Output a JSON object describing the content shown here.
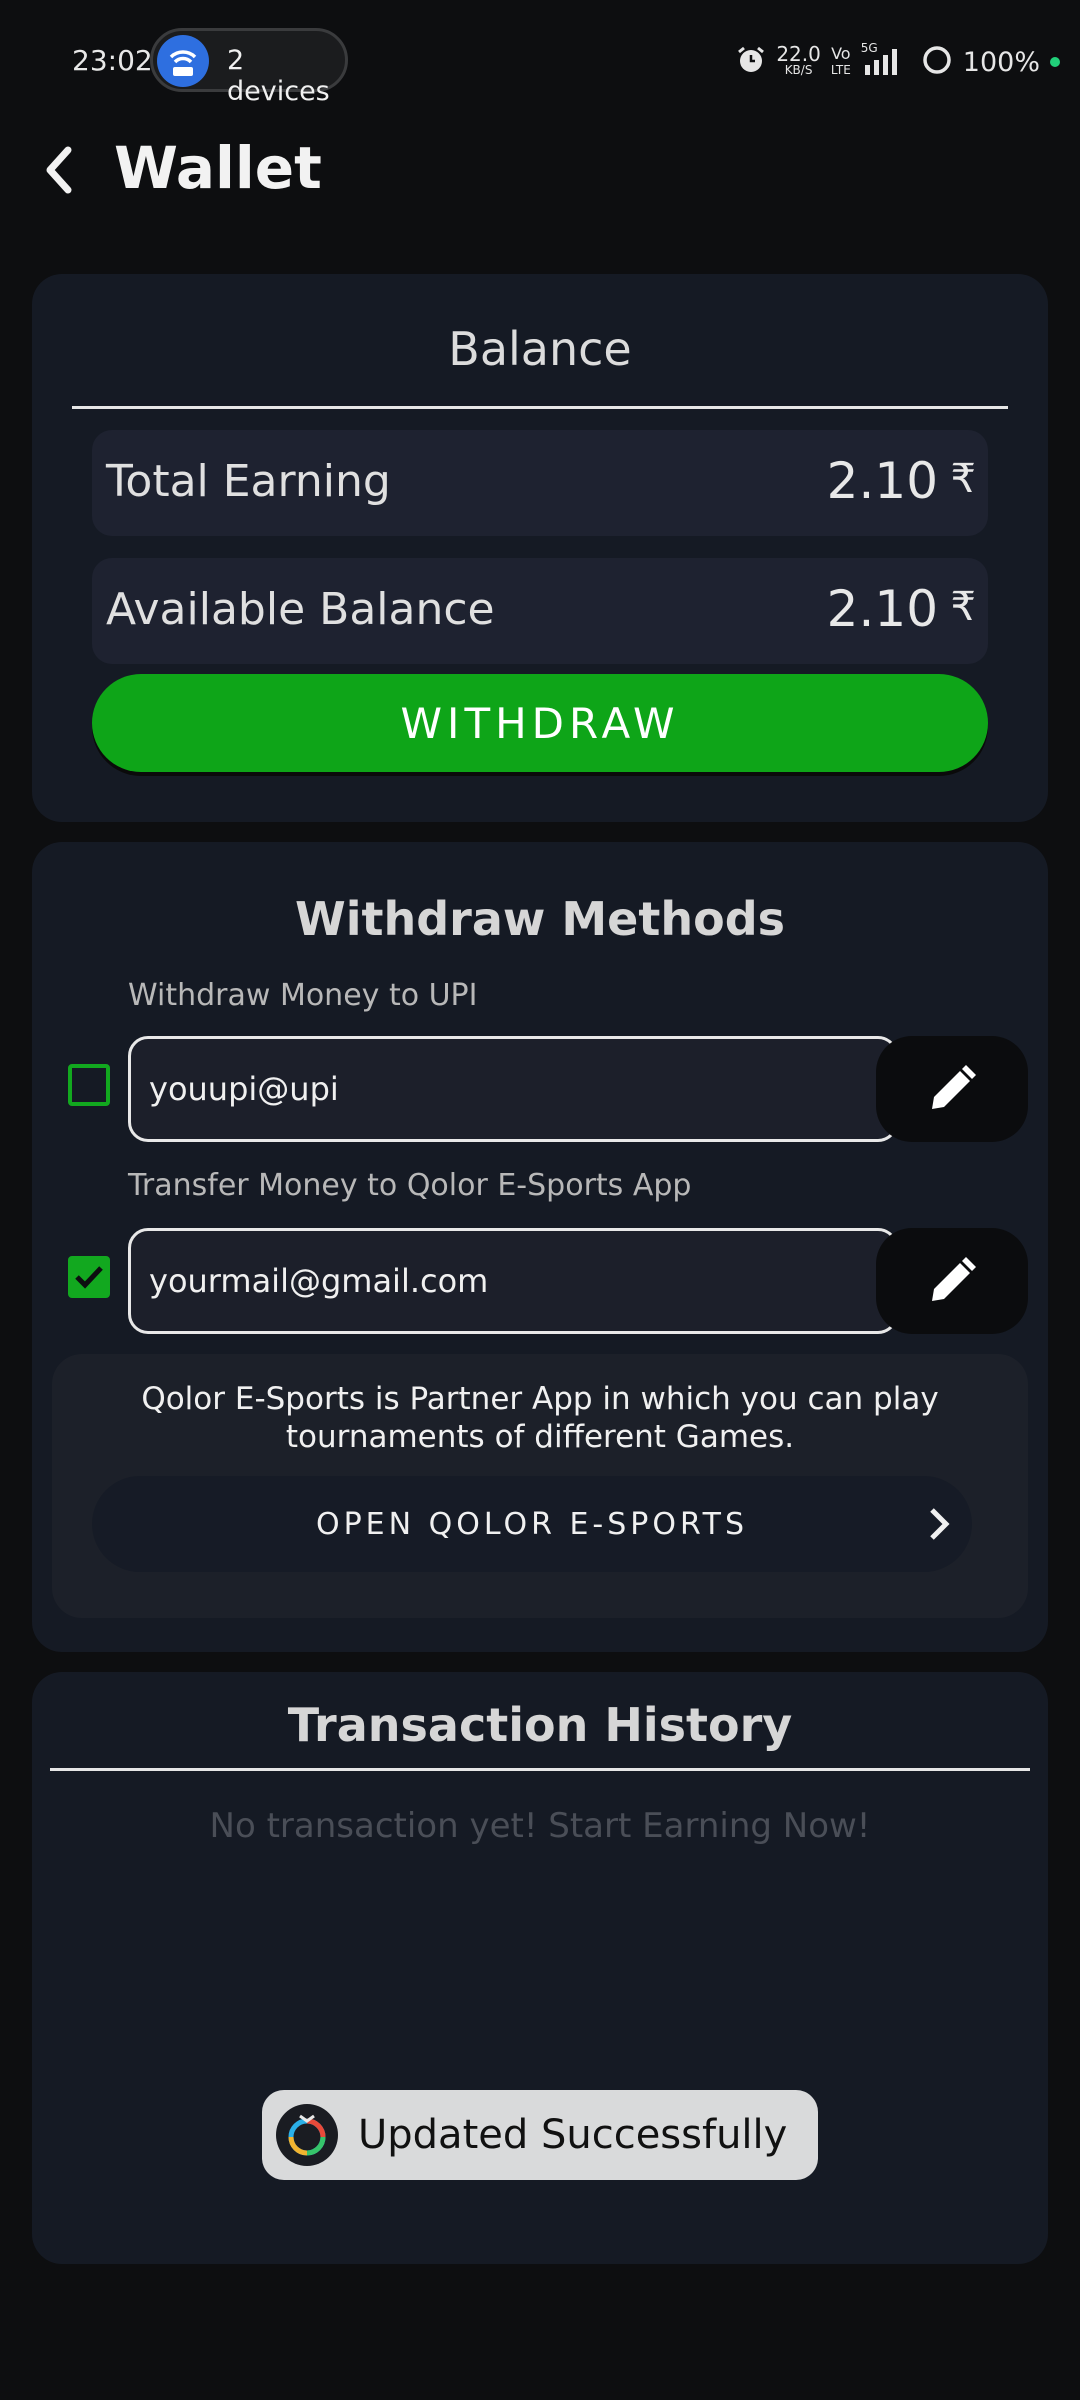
{
  "status_bar": {
    "time": "23:02",
    "hotspot_label": "2 devices",
    "net_speed_value": "22.0",
    "net_speed_unit": "KB/S",
    "volte_top": "Vo",
    "volte_bottom": "LTE",
    "network": "5G",
    "battery": "100%"
  },
  "header": {
    "title": "Wallet"
  },
  "balance": {
    "title": "Balance",
    "total_earning_label": "Total Earning",
    "total_earning_value": "2.10",
    "available_label": "Available Balance",
    "available_value": "2.10",
    "currency": "₹",
    "withdraw_label": "WITHDRAW"
  },
  "methods": {
    "title": "Withdraw Methods",
    "upi_label": "Withdraw Money to UPI",
    "upi_value": "youupi@upi",
    "upi_checked": false,
    "qolor_label": "Transfer Money to Qolor E-Sports App",
    "qolor_value": "yourmail@gmail.com",
    "qolor_checked": true,
    "partner_text": "Qolor E-Sports is Partner App in which you can play tournaments of different Games.",
    "open_label": "OPEN QOLOR E-SPORTS"
  },
  "history": {
    "title": "Transaction History",
    "empty_text": "No transaction yet! Start Earning Now!"
  },
  "toast": {
    "text": "Updated Successfully"
  },
  "colors": {
    "accent_green": "#0ea518",
    "background": "#0d0e10",
    "card": "#151a24"
  }
}
